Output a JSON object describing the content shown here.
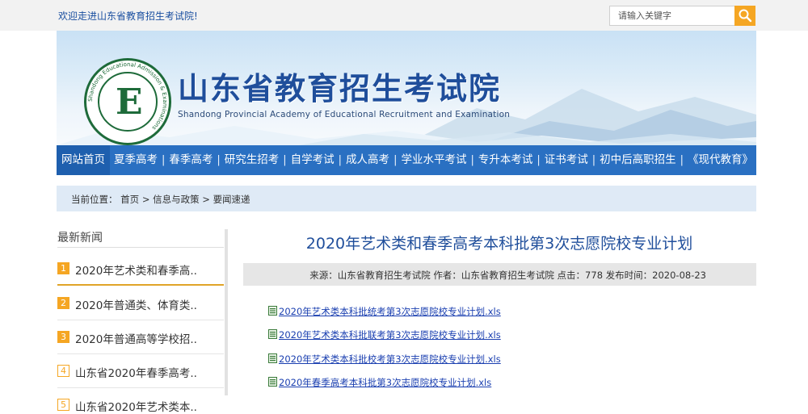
{
  "top": {
    "welcome": "欢迎走进山东省教育招生考试院!",
    "search_placeholder": "请输入关键字"
  },
  "banner": {
    "title": "山东省教育招生考试院",
    "subtitle": "Shandong Provincial Academy of Educational Recruitment and Examination",
    "logo_ring_en": "Shandong Educational Admission & Examinations",
    "logo_ring_cn": "山东省教育招生考试院"
  },
  "nav": {
    "items": [
      "网站首页",
      "夏季高考",
      "春季高考",
      "研究生招考",
      "自学考试",
      "成人高考",
      "学业水平考试",
      "专升本考试",
      "证书考试",
      "初中后高职招生",
      "《现代教育》"
    ]
  },
  "breadcrumb": {
    "prefix": "当前位置：",
    "home": "首页",
    "sep1": ">",
    "level1": "信息与政策",
    "sep2": ">",
    "level2": "要闻速递"
  },
  "sidebar": {
    "title": "最新新闻",
    "items": [
      {
        "num": "1",
        "text": "2020年艺术类和春季高.."
      },
      {
        "num": "2",
        "text": "2020年普通类、体育类.."
      },
      {
        "num": "3",
        "text": "2020年普通高等学校招.."
      },
      {
        "num": "4",
        "text": "山东省2020年春季高考.."
      },
      {
        "num": "5",
        "text": "山东省2020年艺术类本.."
      }
    ]
  },
  "article": {
    "title": "2020年艺术类和春季高考本科批第3次志愿院校专业计划",
    "meta": "来源：山东省教育招生考试院 作者：山东省教育招生考试院 点击：778 发布时间：2020-08-23",
    "files": [
      "2020年艺术类本科批统考第3次志愿院校专业计划.xls",
      "2020年艺术类本科批联考第3次志愿院校专业计划.xls",
      "2020年艺术类本科批校考第3次志愿院校专业计划.xls",
      "2020年春季高考本科批第3次志愿院校专业计划.xls"
    ]
  },
  "colors": {
    "nav_bg": "#2a70c2",
    "title_blue": "#1f4e9b",
    "accent_orange": "#f5a623",
    "link_blue": "#1a3fb0"
  }
}
